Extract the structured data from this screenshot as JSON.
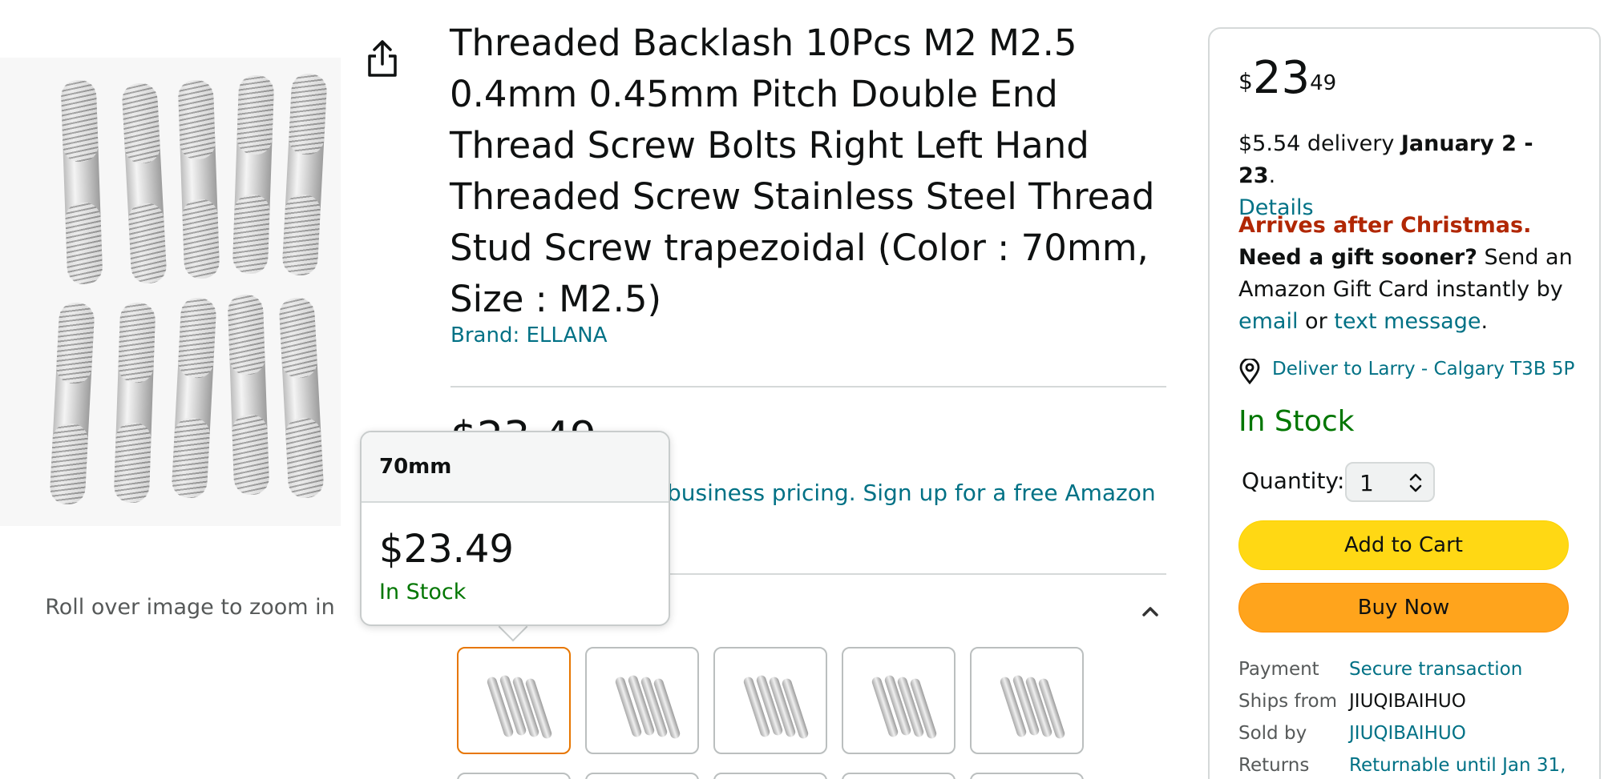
{
  "gallery": {
    "zoom_hint": "Roll over image to zoom in"
  },
  "product": {
    "title": "Threaded Backlash 10Pcs M2 M2.5 0.4mm 0.45mm Pitch Double End Thread Screw Bolts Right Left Hand Threaded Screw Stainless Steel Thread Stud Screw trapezoidal (Color : 70mm, Size : M2.5)",
    "brand": "Brand: ELLANA",
    "partial_price": "$23.49",
    "business_text": "business pricing. Sign up for a free Amazon"
  },
  "popover": {
    "size": "70mm",
    "price": "$23.49",
    "stock": "In Stock"
  },
  "buy_box": {
    "price_symbol": "$",
    "price_whole": "23",
    "price_fraction": "49",
    "delivery_fee": "$5.54 delivery ",
    "delivery_dates": "January 2 - 23",
    "delivery_period": ".",
    "details_link": "Details",
    "arrives_after": "Arrives after Christmas.",
    "need_gift": " Need a gift sooner?",
    "gift_text": " Send an Amazon Gift Card instantly by ",
    "email_link": "email",
    "or_text": " or ",
    "text_message_link": "text message",
    "gift_period": ".",
    "deliver_to": "Deliver to Larry - Calgary T3B 5P",
    "stock": "In Stock",
    "quantity_label": "Quantity:",
    "quantity_value": "1",
    "add_to_cart": "Add to Cart",
    "buy_now": "Buy Now",
    "info": [
      {
        "label": "Payment",
        "value": "Secure transaction"
      },
      {
        "label": "Ships from",
        "value": "JIUQIBAIHUO"
      },
      {
        "label": "Sold by",
        "value": "JIUQIBAIHUO"
      },
      {
        "label": "Returns",
        "value": "Returnable until Jan 31,"
      }
    ]
  },
  "colors": {
    "link": "#007185",
    "in_stock": "#007600",
    "alert_red": "#b12704",
    "add_to_cart": "#ffd814",
    "buy_now": "#ffa41c",
    "selected_swatch": "#e77600"
  },
  "icons": [
    "share-icon",
    "chevron-up-icon",
    "location-icon",
    "select-arrows-icon"
  ]
}
